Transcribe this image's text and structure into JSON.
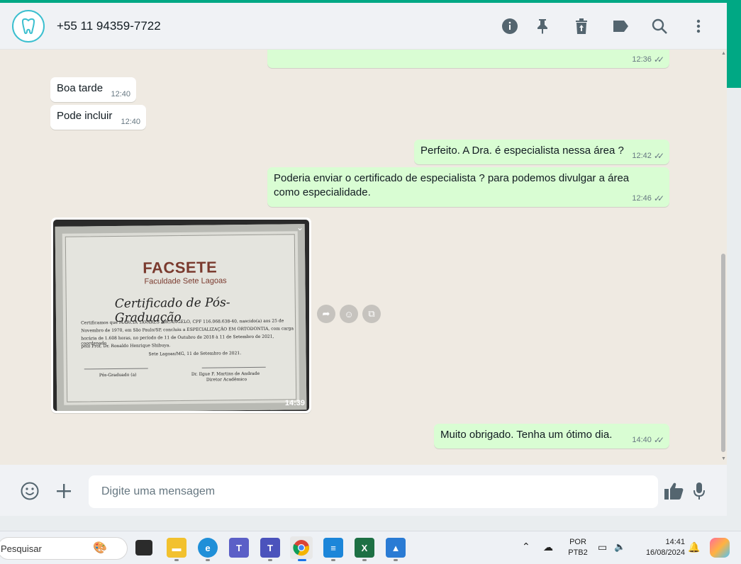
{
  "header": {
    "contact_name": "+55 11 94359-7722",
    "icons": [
      "info-icon",
      "pin-icon",
      "delete-icon",
      "label-icon",
      "search-icon",
      "menu-icon"
    ]
  },
  "messages": [
    {
      "dir": "out",
      "text": "",
      "time": "12:36",
      "ticks": "✓✓"
    },
    {
      "dir": "in",
      "text": "Boa tarde",
      "time": "12:40"
    },
    {
      "dir": "in",
      "text": "Pode incluir",
      "time": "12:40"
    },
    {
      "dir": "out",
      "text": "Perfeito. A Dra. é especialista nessa área ?",
      "time": "12:42",
      "ticks": "✓✓"
    },
    {
      "dir": "out",
      "text": "Poderia enviar o certificado de especialista ? para podemos divulgar a área como especialidade.",
      "time": "12:46",
      "ticks": "✓✓"
    },
    {
      "dir": "in",
      "type": "image",
      "time": "14:39"
    },
    {
      "dir": "out",
      "text": "Muito obrigado. Tenha um ótimo dia.",
      "time": "14:40",
      "ticks": "✓✓"
    }
  ],
  "certificate": {
    "logo": "FACSETE",
    "subtitle": "Faculdade Sete Lagoas",
    "title": "Certificado de Pós-Graduação",
    "body_1": "Certificamos que MARCIA TAVARES ARCANGELO, CPF 116.068.638-40, nascido(a) aos 25 de",
    "body_2": "Novembro de 1970, em São Paulo/SP, concluiu a ESPECIALIZAÇÃO EM ORTODONTIA, com carga",
    "body_3": "horária de 1.608 horas, no período de 11 de Outubro de 2018 à 11 de Setembro de 2021, coordenado",
    "body_4": "pelo Prof. Dr. Ronaldo Henrique Shibuya.",
    "place_date": "Sete Lagoas/MG, 11 de Setembro de 2021.",
    "sig_left": "Pós-Graduado (a)",
    "sig_right_1": "Dr. Ilgue F. Martins de Andrade",
    "sig_right_2": "Diretor Acadêmico"
  },
  "composer": {
    "placeholder": "Digite uma mensagem"
  },
  "taskbar": {
    "search_label": "Pesquisar",
    "lang_1": "POR",
    "lang_2": "PTB2",
    "time": "14:41",
    "date": "16/08/2024"
  },
  "colors": {
    "accent": "#00a884",
    "outgoing_bubble": "#d9fdd3",
    "incoming_bubble": "#ffffff",
    "chat_bg": "#efeae2"
  }
}
